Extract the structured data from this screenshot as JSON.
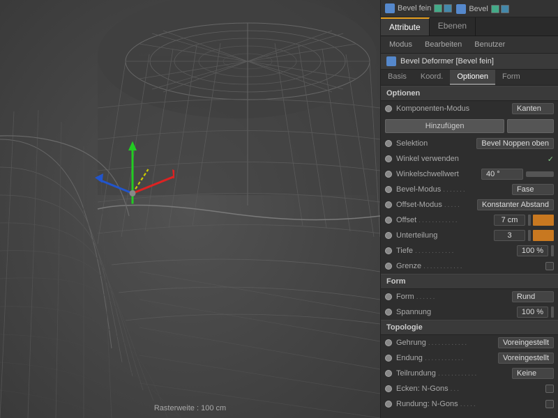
{
  "viewport": {
    "label": "Rasterweite : 100 cm"
  },
  "panel": {
    "layers": [
      {
        "name": "Bevel fein",
        "icon": "cube",
        "checked1": true,
        "checked2": true
      },
      {
        "name": "Bevel",
        "icon": "cube",
        "checked1": true,
        "checked2": true
      }
    ],
    "tabs": [
      {
        "id": "attribute",
        "label": "Attribute",
        "active": true
      },
      {
        "id": "ebenen",
        "label": "Ebenen",
        "active": false
      }
    ],
    "sub_tabs": [
      {
        "id": "modus",
        "label": "Modus",
        "active": false
      },
      {
        "id": "bearbeiten",
        "label": "Bearbeiten",
        "active": false
      },
      {
        "id": "benutzer",
        "label": "Benutzer",
        "active": false
      }
    ],
    "title": "Bevel Deformer [Bevel fein]",
    "inner_tabs": [
      {
        "id": "basis",
        "label": "Basis",
        "active": false
      },
      {
        "id": "koord",
        "label": "Koord.",
        "active": false
      },
      {
        "id": "optionen",
        "label": "Optionen",
        "active": true
      },
      {
        "id": "form",
        "label": "Form",
        "active": false
      }
    ],
    "sections": {
      "optionen": {
        "label": "Optionen",
        "komponenten_modus_label": "Komponenten-Modus",
        "komponenten_modus_value": "Kanten",
        "add_button": "Hinzufügen",
        "selektion_label": "Selektion",
        "selektion_value": "Bevel Noppen oben",
        "winkel_verwenden_label": "Winkel verwenden",
        "winkel_checked": true,
        "winkelschwellwert_label": "Winkelschwellwert",
        "winkelschwellwert_value": "40 °",
        "bevel_modus_label": "Bevel-Modus",
        "bevel_modus_dots": ".....",
        "bevel_modus_value": "Fase",
        "offset_modus_label": "Offset-Modus",
        "offset_modus_dots": ".....",
        "offset_modus_value": "Konstanter Abstand",
        "offset_label": "Offset",
        "offset_dots": "...........",
        "offset_num": "7 cm",
        "unterteilung_label": "Unterteilung",
        "unterteilung_num": "3",
        "tiefe_label": "Tiefe",
        "tiefe_dots": "...........",
        "tiefe_num": "100 %",
        "grenze_label": "Grenze",
        "grenze_dots": "..........."
      },
      "form": {
        "label": "Form",
        "form_label": "Form",
        "form_dots": "....",
        "form_value": "Rund",
        "spannung_label": "Spannung",
        "spannung_num": "100 %"
      },
      "topologie": {
        "label": "Topologie",
        "gehrung_label": "Gehrung",
        "gehrung_dots": "............",
        "gehrung_value": "Voreingestellt",
        "endung_label": "Endung",
        "endung_dots": "............",
        "endung_value": "Voreingestellt",
        "teilrundung_label": "Teilrundung",
        "teilrundung_dots": "............",
        "teilrundung_value": "Keine",
        "ecken_ngons_label": "Ecken: N-Gons",
        "ecken_dots": "...",
        "rundung_ngons_label": "Rundung: N-Gons",
        "rundung_dots": "....."
      }
    }
  }
}
